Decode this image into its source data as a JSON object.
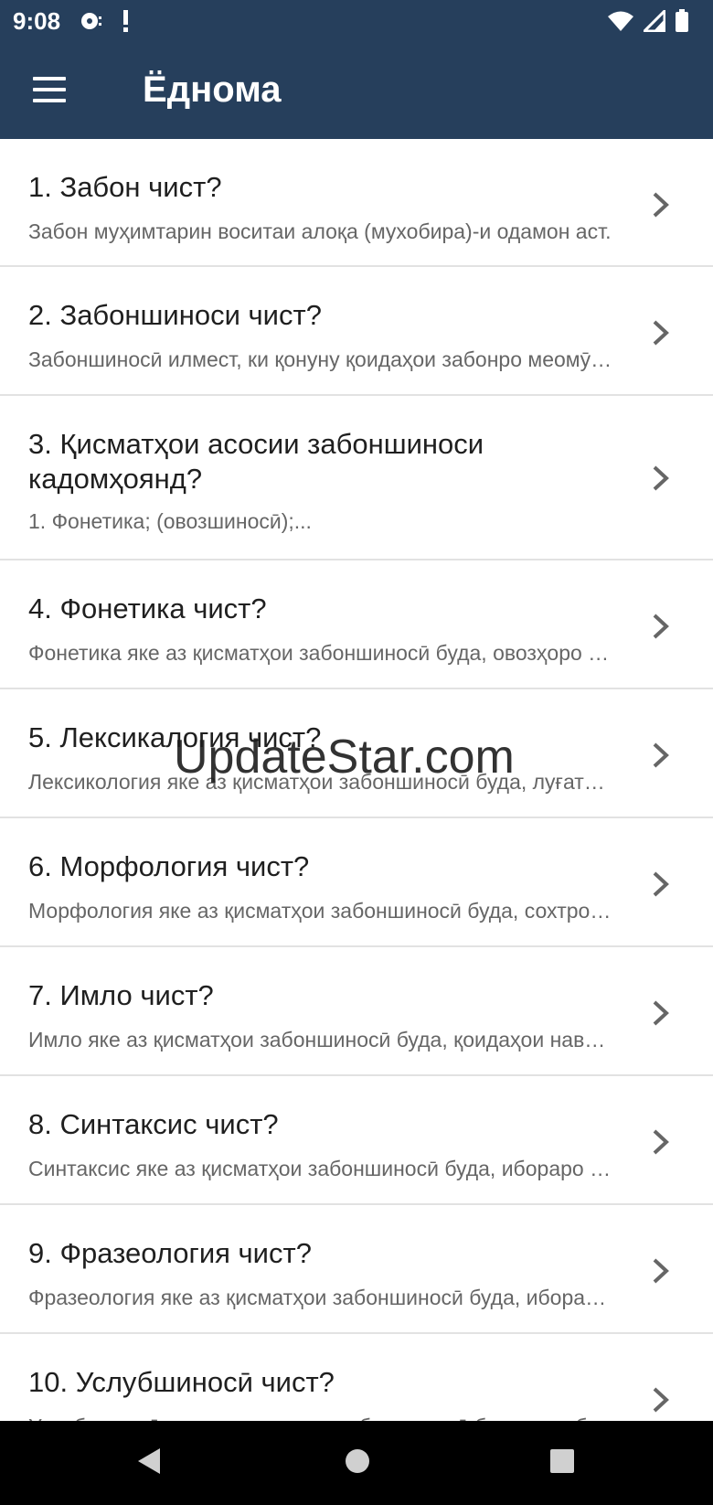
{
  "status_bar": {
    "time": "9:08",
    "left_icons": [
      "media-icon",
      "alert-icon"
    ],
    "right_icons": [
      "wifi-icon",
      "signal-icon",
      "battery-icon"
    ]
  },
  "app_bar": {
    "title": "Ёднома",
    "menu_icon": "hamburger-menu-icon"
  },
  "items": [
    {
      "title": "1. Забон чист?",
      "subtitle": "Забон муҳимтарин воситаи алоқа (мухобира)-и одамон аст."
    },
    {
      "title": "2. Забоншиноси чист?",
      "subtitle": "Забоншиносӣ илмест, ки қонуну қоидаҳои забонро меомӯзад."
    },
    {
      "title": "3. Қисматҳои асосии забоншиноси кадомҳоянд?",
      "subtitle": "1. Фонетика; (овозшиносӣ);..."
    },
    {
      "title": "4. Фонетика чист?",
      "subtitle": "Фонетика яке аз қисматҳои забоншиносӣ буда, овозҳоро меомӯзад."
    },
    {
      "title": "5. Лексикалогия чист?",
      "subtitle": "Лексикология яке аз қисматҳои забоншиносӣ буда, луғатро меомӯзад."
    },
    {
      "title": "6. Морфология чист?",
      "subtitle": "Морфология яке аз қисматҳои забоншиносӣ буда, сохтро меомӯзад."
    },
    {
      "title": "7. Имло чист?",
      "subtitle": "Имло яке аз қисматҳои забоншиносӣ буда, қоидаҳои навиштанро меомӯзад."
    },
    {
      "title": "8. Синтаксис чист?",
      "subtitle": "Синтаксис яке аз қисматҳои забоншиносӣ буда, ибораро меомӯзад."
    },
    {
      "title": "9. Фразеология чист?",
      "subtitle": "Фразеология яке аз қисматҳои забоншиносӣ буда, ибораҳоро меомӯзад."
    },
    {
      "title": "10. Услубшиносӣ чист?",
      "subtitle": "Услубшиносӣ яке аз қисматҳои забоншиносӣ буда, услубро меомӯзад."
    }
  ],
  "watermark": "UpdateStar.com",
  "nav_bar": {
    "back_icon": "back-triangle-icon",
    "home_icon": "home-circle-icon",
    "recents_icon": "recents-square-icon"
  },
  "colors": {
    "app_bar": "#263f5c",
    "divider": "#e2e2e2",
    "title_text": "#1f1f1f",
    "subtitle_text": "#666666"
  }
}
